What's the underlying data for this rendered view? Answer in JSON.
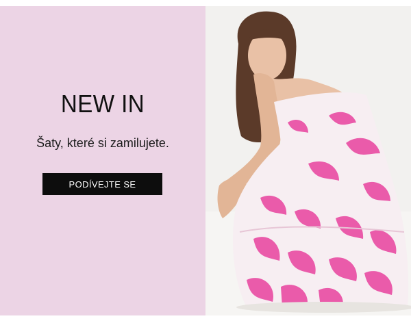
{
  "hero": {
    "headline": "NEW IN",
    "subline": "Šaty, které si zamilujete.",
    "cta_label": "PODÍVEJTE SE"
  },
  "colors": {
    "panel_background": "#ecd4e5",
    "button_background": "#0d0d0d",
    "button_text": "#ffffff",
    "photo_background": "#f1f0ee",
    "dress_pink": "#e94ca3"
  },
  "image": {
    "semantic": "model-photo"
  }
}
